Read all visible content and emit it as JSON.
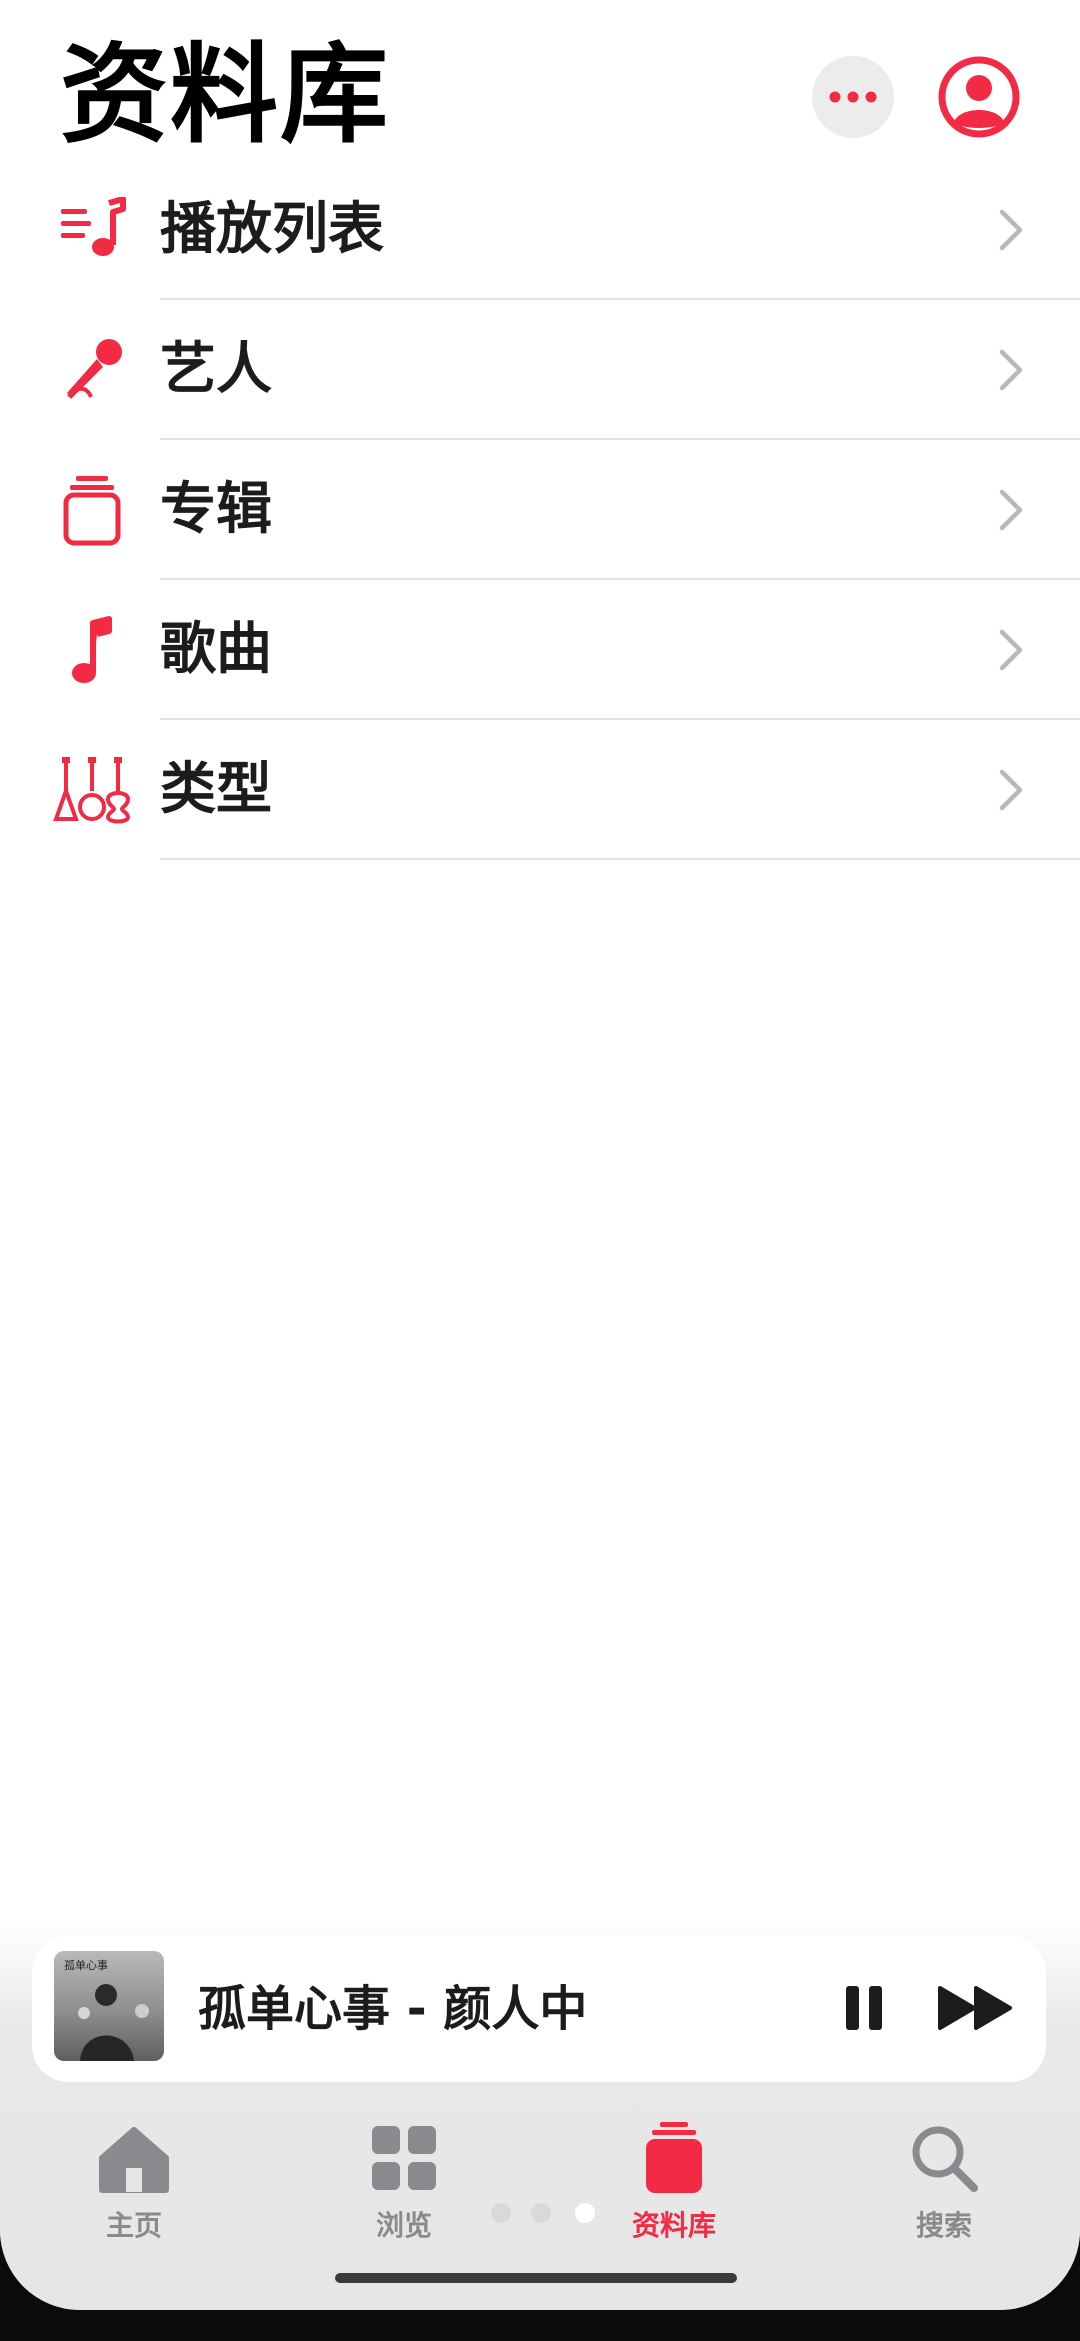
{
  "header": {
    "title": "资料库",
    "more_icon": "ellipsis-icon",
    "account_icon": "person-circle-icon"
  },
  "accent_color": "#f22a44",
  "library_items": [
    {
      "label": "播放列表",
      "icon": "playlist-icon"
    },
    {
      "label": "艺人",
      "icon": "microphone-icon"
    },
    {
      "label": "专辑",
      "icon": "album-stack-icon"
    },
    {
      "label": "歌曲",
      "icon": "music-note-icon"
    },
    {
      "label": "类型",
      "icon": "guitars-icon"
    }
  ],
  "mini_player": {
    "now_playing": "孤单心事 - 颜人中",
    "artwork_text": "孤单心事",
    "pause_icon": "pause-icon",
    "next_icon": "forward-icon"
  },
  "tabs": [
    {
      "label": "主页",
      "icon": "house-icon",
      "active": false
    },
    {
      "label": "浏览",
      "icon": "grid-icon",
      "active": false
    },
    {
      "label": "资料库",
      "icon": "library-icon",
      "active": true
    },
    {
      "label": "搜索",
      "icon": "magnifier-icon",
      "active": false
    }
  ]
}
